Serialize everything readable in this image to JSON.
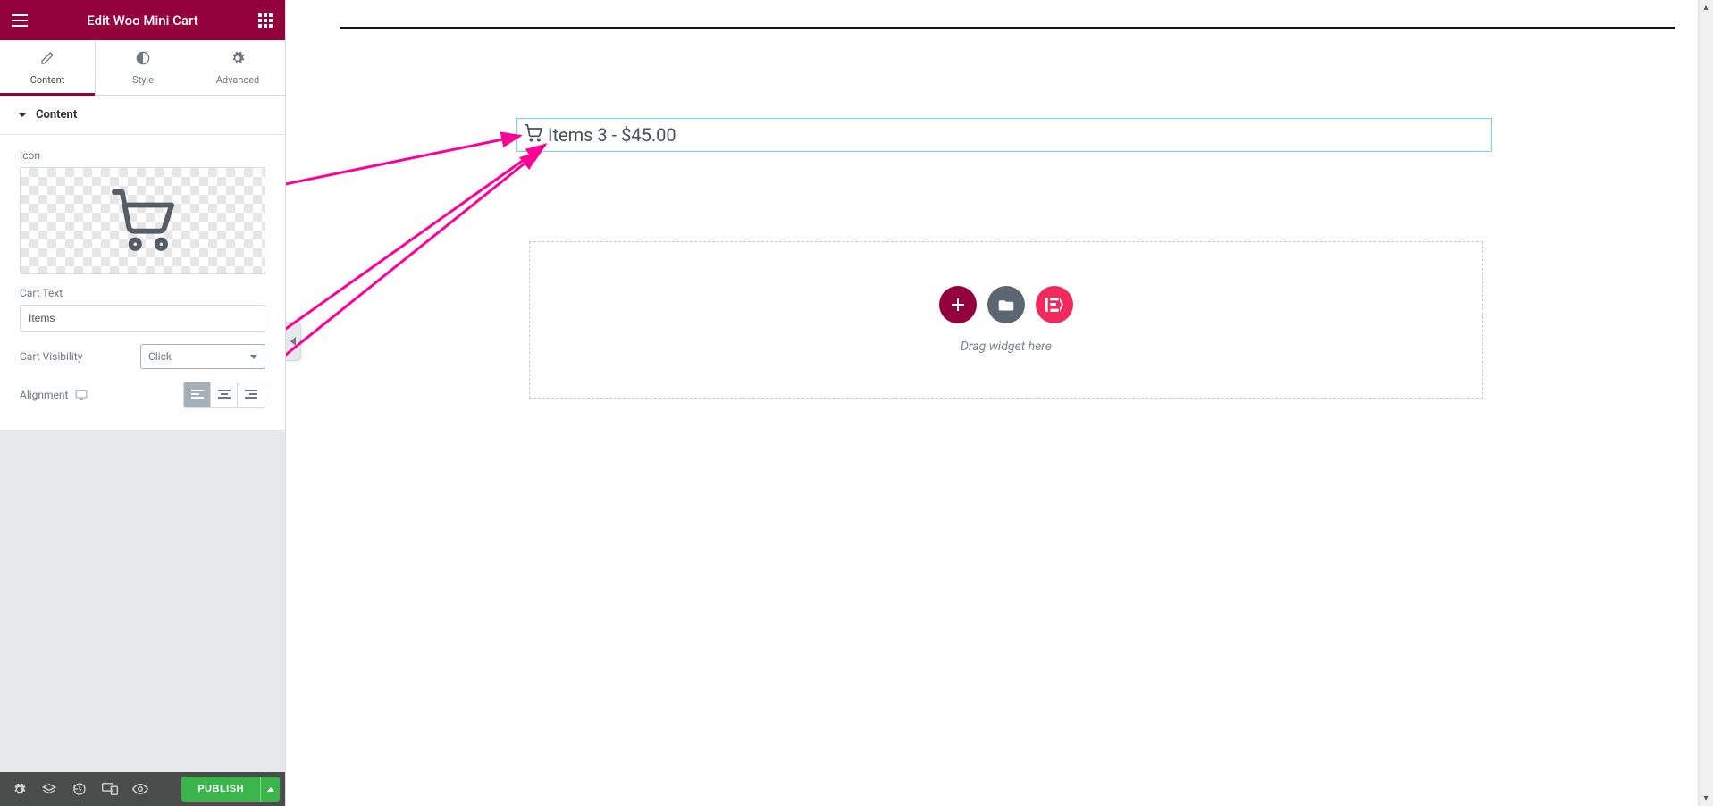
{
  "header": {
    "title": "Edit Woo Mini Cart"
  },
  "tabs": {
    "content": "Content",
    "style": "Style",
    "advanced": "Advanced"
  },
  "section": {
    "title": "Content"
  },
  "controls": {
    "icon_label": "Icon",
    "cart_text_label": "Cart Text",
    "cart_text_value": "Items",
    "cart_visibility_label": "Cart Visibility",
    "cart_visibility_value": "Click",
    "alignment_label": "Alignment"
  },
  "footer": {
    "publish_label": "PUBLISH"
  },
  "canvas": {
    "mini_cart_text": "Items 3 - $45.00",
    "drop_text": "Drag widget here"
  }
}
